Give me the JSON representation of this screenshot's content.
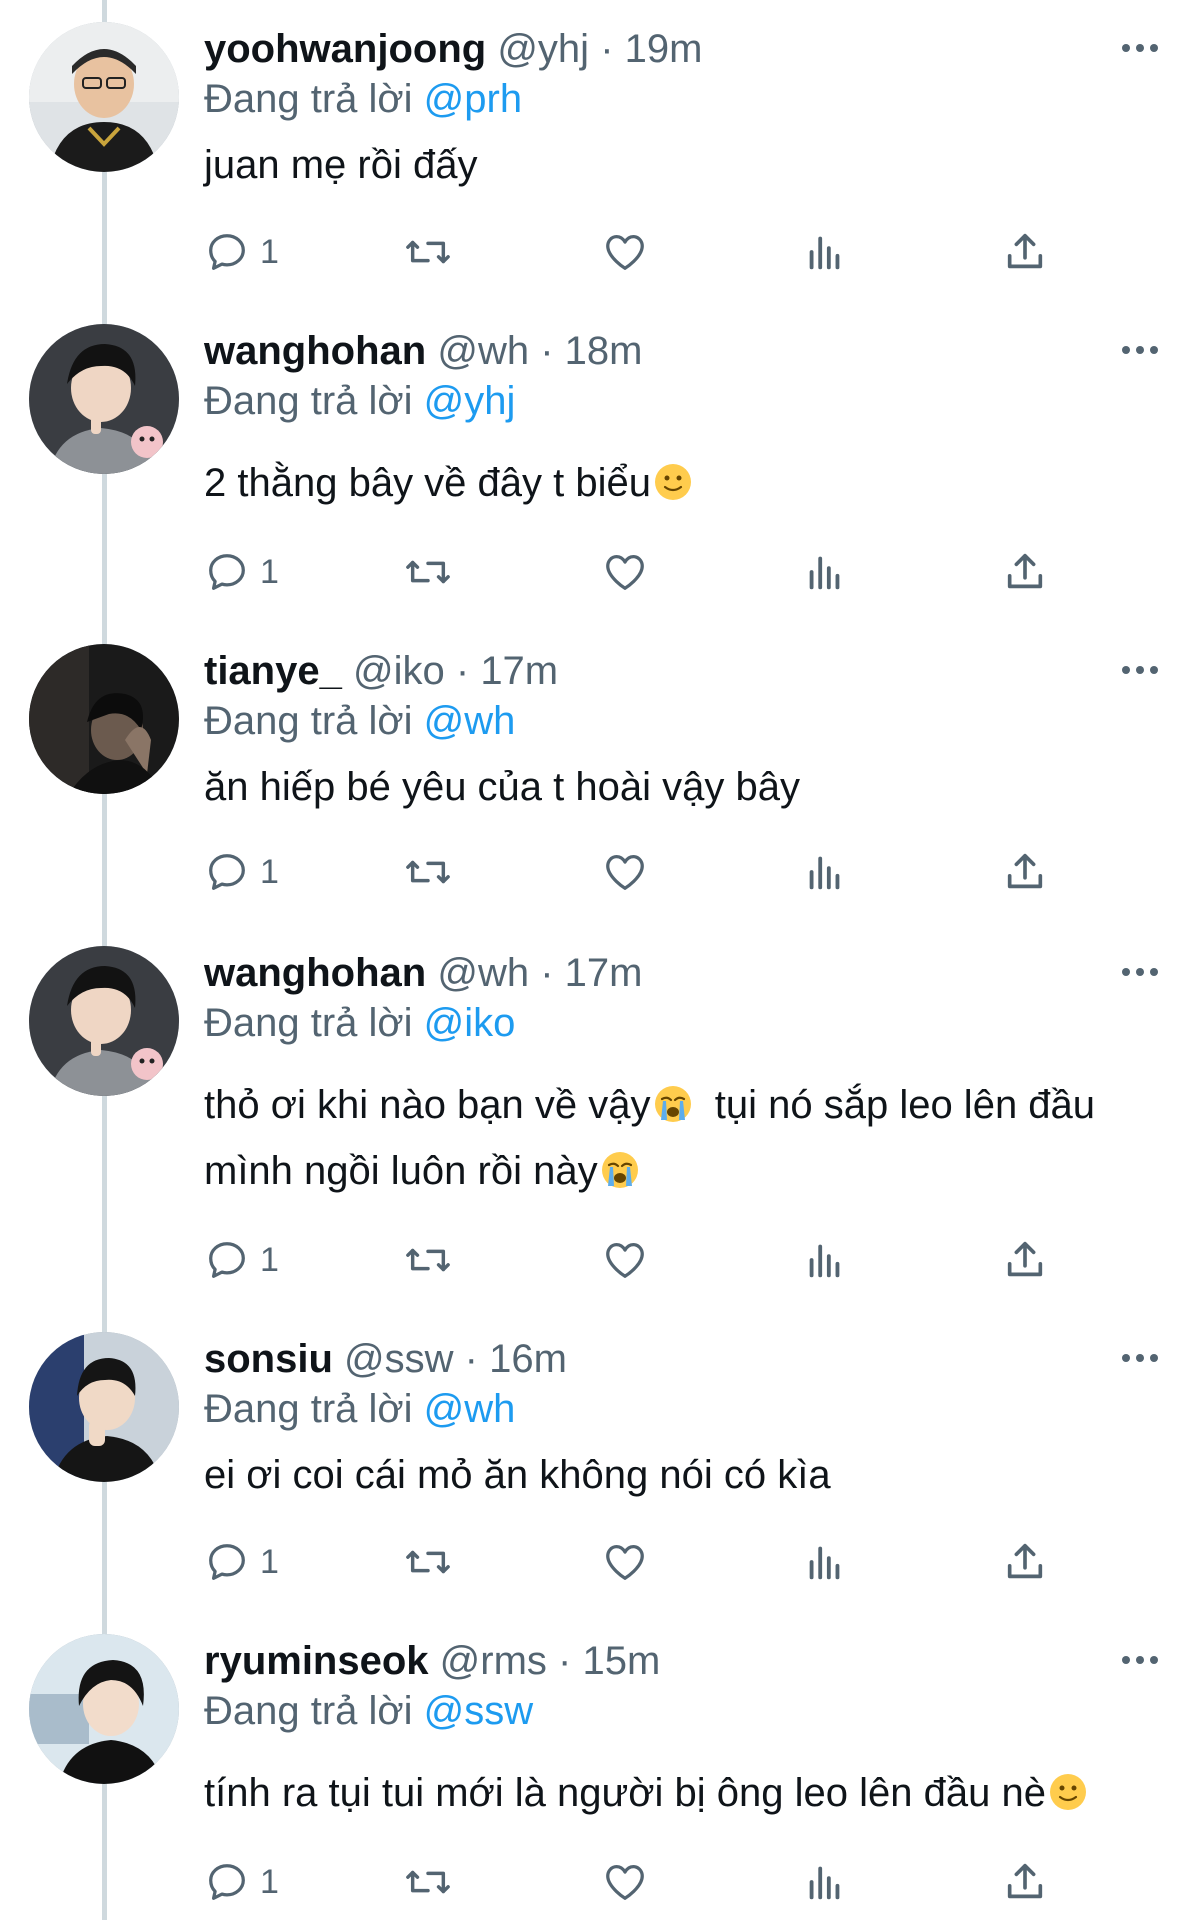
{
  "tweets": [
    {
      "username": "yoohwanjoong",
      "handle": "@yhj",
      "time": "19m",
      "reply_prefix": "Đang trả lời",
      "reply_to": "@prh",
      "lines": [
        "juan mẹ rồi đấy"
      ],
      "reply_count": "1"
    },
    {
      "username": "wanghohan",
      "handle": "@wh",
      "time": "18m",
      "reply_prefix": "Đang trả lời",
      "reply_to": "@yhj",
      "lines": [
        "2 thằng bây về đây t biểu"
      ],
      "reply_count": "1"
    },
    {
      "username": "tianye_",
      "handle": "@iko",
      "time": "17m",
      "reply_prefix": "Đang trả lời",
      "reply_to": "@wh",
      "lines": [
        "ăn hiếp bé yêu của t hoài vậy bây"
      ],
      "reply_count": "1"
    },
    {
      "username": "wanghohan",
      "handle": "@wh",
      "time": "17m",
      "reply_prefix": "Đang trả lời",
      "reply_to": "@iko",
      "lines": [
        "thỏ ơi khi nào bạn về vậy",
        "  tụi nó sắp leo lên đầu",
        "mình ngồi luôn rồi này"
      ],
      "reply_count": "1"
    },
    {
      "username": "sonsiu",
      "handle": "@ssw",
      "time": "16m",
      "reply_prefix": "Đang trả lời",
      "reply_to": "@wh",
      "lines": [
        "ei ơi coi cái mỏ ăn không nói có kìa"
      ],
      "reply_count": "1"
    },
    {
      "username": "ryuminseok",
      "handle": "@rms",
      "time": "15m",
      "reply_prefix": "Đang trả lời",
      "reply_to": "@ssw",
      "lines": [
        "tính ra tụi tui mới là người bị ông leo lên đầu nè"
      ],
      "reply_count": "1"
    }
  ],
  "icons": {
    "reply": "reply-icon",
    "retweet": "retweet-icon",
    "like": "heart-icon",
    "views": "views-icon",
    "share": "share-icon",
    "more": "more-icon",
    "slight_smile": "slightly-smiling-face-emoji",
    "crying": "loudly-crying-face-emoji"
  },
  "colors": {
    "text": "#0f1419",
    "secondary": "#536471",
    "link": "#1d9bf0",
    "thread_line": "#cfd9de"
  }
}
